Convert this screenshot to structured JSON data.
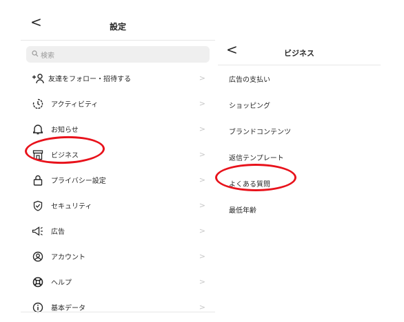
{
  "settings_panel": {
    "back_glyph": "<",
    "title": "設定",
    "search_placeholder": "検索",
    "items": [
      {
        "label": "友達をフォロー・招待する",
        "icon": "add-person-icon"
      },
      {
        "label": "アクティビティ",
        "icon": "activity-clock-icon"
      },
      {
        "label": "お知らせ",
        "icon": "bell-icon"
      },
      {
        "label": "ビジネス",
        "icon": "shop-icon"
      },
      {
        "label": "プライバシー設定",
        "icon": "lock-icon"
      },
      {
        "label": "セキュリティ",
        "icon": "shield-check-icon"
      },
      {
        "label": "広告",
        "icon": "megaphone-icon"
      },
      {
        "label": "アカウント",
        "icon": "account-circle-icon"
      },
      {
        "label": "ヘルプ",
        "icon": "lifebuoy-icon"
      },
      {
        "label": "基本データ",
        "icon": "info-icon"
      }
    ]
  },
  "business_panel": {
    "back_glyph": "<",
    "title": "ビジネス",
    "items": [
      {
        "label": "広告の支払い"
      },
      {
        "label": "ショッピング"
      },
      {
        "label": "ブランドコンテンツ"
      },
      {
        "label": "返信テンプレート"
      },
      {
        "label": "よくある質問"
      },
      {
        "label": "最低年齢"
      }
    ]
  },
  "chevron_glyph": ">",
  "colors": {
    "highlight": "#e8121b",
    "text": "#262626",
    "muted": "#9a9a9a",
    "search_bg": "#efefef"
  }
}
